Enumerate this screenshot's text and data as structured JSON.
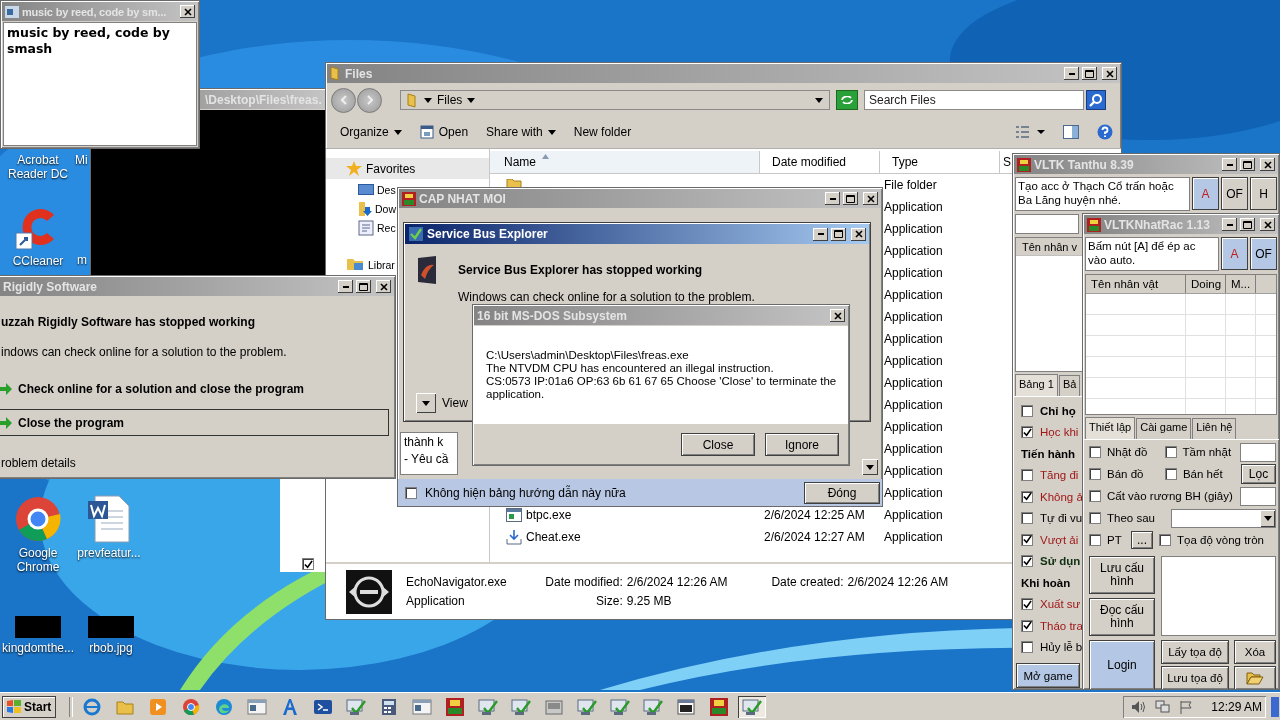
{
  "desktop_icons": [
    {
      "label": "Acrobat Reader DC",
      "kind": "none"
    },
    {
      "label": "Mi",
      "kind": "none"
    },
    {
      "label": "CCleaner",
      "kind": "ccleaner"
    },
    {
      "label": "m",
      "kind": "none"
    },
    {
      "label": "Google Chrome",
      "kind": "chrome"
    },
    {
      "label": "prevfeatur...",
      "kind": "document"
    },
    {
      "label": "kingdomthe...",
      "kind": "thumbnail"
    },
    {
      "label": "rbob.jpg",
      "kind": "thumbnail"
    }
  ],
  "console_window": {
    "title": "\\Desktop\\Files\\freas."
  },
  "music_window": {
    "title": "music by reed, code by sm...",
    "text": "music by reed, code by smash"
  },
  "back_window": {
    "checked": true
  },
  "explorer": {
    "title": "Files",
    "address": "Files",
    "search": {
      "placeholder": "Search Files"
    },
    "toolbar": [
      {
        "label": "Organize",
        "kind": "menu"
      },
      {
        "label": "Open",
        "kind": "open"
      },
      {
        "label": "Share with",
        "kind": "menu"
      },
      {
        "label": "New folder",
        "kind": "plain"
      }
    ],
    "sidebar": [
      {
        "label": "Favorites",
        "kind": "favorites",
        "selected": true
      },
      {
        "label": "Des",
        "kind": "desktop",
        "selected": false
      },
      {
        "label": "Dow",
        "kind": "downloads",
        "selected": false
      },
      {
        "label": "Rec",
        "kind": "recent",
        "selected": false
      },
      {
        "label": "Librar",
        "kind": "libraries",
        "selected": false
      }
    ],
    "columns": [
      {
        "label": "Name",
        "sorted": true
      },
      {
        "label": "Date modified",
        "sorted": false
      },
      {
        "label": "Type",
        "sorted": false
      },
      {
        "label": "S",
        "sorted": false
      }
    ],
    "rows": [
      {
        "type": "File folder",
        "kind": "folder"
      },
      {
        "type": "Application"
      },
      {
        "type": "Application"
      },
      {
        "type": "Application"
      },
      {
        "type": "Application"
      },
      {
        "type": "Application"
      },
      {
        "type": "Application"
      },
      {
        "type": "Application"
      },
      {
        "type": "Application"
      },
      {
        "type": "Application"
      },
      {
        "type": "Application"
      },
      {
        "type": "Application"
      },
      {
        "type": "Application"
      },
      {
        "type": "Application"
      },
      {
        "type": "Application"
      },
      {
        "name": "btpc.exe",
        "date": "2/6/2024 12:25 AM",
        "type": "Application",
        "kind": "window"
      },
      {
        "name": "Cheat.exe",
        "date": "2/6/2024 12:27 AM",
        "type": "Application",
        "kind": "download"
      }
    ],
    "details": {
      "name": "EchoNavigator.exe",
      "type": "Application",
      "modified_label": "Date modified:",
      "modified": "2/6/2024 12:26 AM",
      "created_label": "Date created:",
      "created": "2/6/2024 12:26 AM",
      "size_label": "Size:",
      "size": "9.25 MB"
    }
  },
  "rigidly_dialog": {
    "title": "Rigidly Software",
    "heading": "uzzah Rigidly Software has stopped working",
    "message": "indows can check online for a solution to the problem.",
    "options": [
      {
        "label": "Check online for a solution and close the program",
        "selected": false
      },
      {
        "label": "Close the program",
        "selected": true
      }
    ],
    "details": "roblem details"
  },
  "update_window": {
    "title": "CAP NHAT MOI",
    "note_lines": [
      "thành k",
      "- Yêu cầ"
    ],
    "hide_guide": {
      "label": "Không hiện bảng hướng dẫn này nữa",
      "checked": false
    },
    "close_button": "Đóng"
  },
  "servicebus_dialog": {
    "title": "Service Bus Explorer",
    "heading": "Service Bus Explorer has stopped working",
    "message": "Windows can check online for a solution to the problem.",
    "details_toggle": "View"
  },
  "msdos_dialog": {
    "title": "16 bit MS-DOS Subsystem",
    "message": [
      "C:\\Users\\admin\\Desktop\\Files\\freas.exe",
      "The NTVDM CPU has encountered an illegal instruction.",
      "CS:0573 IP:01a6 OP:63 6b 61 67 65 Choose 'Close' to terminate the application."
    ],
    "buttons": [
      "Close",
      "Ignore"
    ]
  },
  "tanthu_window": {
    "title": "VLTK Tanthu 8.39",
    "notice": "Tạo acc ở Thạch Cổ trấn hoặc Ba Lăng huyện nhé.",
    "mode_buttons": [
      {
        "label": "A",
        "selected": true
      },
      {
        "label": "OF",
        "selected": false
      },
      {
        "label": "H",
        "selected": false
      }
    ],
    "list_header": "Tên nhân v",
    "tabs": [
      {
        "label": "Bảng 1",
        "selected": true
      },
      {
        "label": "Bả",
        "selected": false
      }
    ],
    "options": [
      {
        "kind": "check",
        "label": "Chỉ họ",
        "checked": false,
        "bold": true,
        "color": "#000000"
      },
      {
        "kind": "check",
        "label": "Học khi",
        "checked": true,
        "bold": false,
        "color": "#a01818"
      },
      {
        "kind": "heading",
        "label": "Tiến hành"
      },
      {
        "kind": "check",
        "label": "Tăng đi",
        "checked": false,
        "bold": false,
        "color": "#a01818"
      },
      {
        "kind": "check",
        "label": "Không ả",
        "checked": true,
        "bold": false,
        "color": "#a01818"
      },
      {
        "kind": "check",
        "label": "Tự đi vu",
        "checked": false,
        "bold": false,
        "color": "#000000"
      },
      {
        "kind": "check",
        "label": "Vượt ải",
        "checked": true,
        "bold": false,
        "color": "#a01818"
      },
      {
        "kind": "check",
        "label": "Sử dụn",
        "checked": true,
        "bold": true,
        "color": "#103010"
      },
      {
        "kind": "heading",
        "label": "Khi hoàn"
      },
      {
        "kind": "check",
        "label": "Xuất sư",
        "checked": true,
        "bold": false,
        "color": "#a01818"
      },
      {
        "kind": "check",
        "label": "Tháo tra",
        "checked": true,
        "bold": false,
        "color": "#a01818"
      },
      {
        "kind": "check",
        "label": "Hủy lễ b",
        "checked": false,
        "bold": false,
        "color": "#000000"
      }
    ],
    "open_game_button": "Mở game"
  },
  "nhatrac_window": {
    "title": "VLTKNhatRac 1.13",
    "notice": "Bấm nút [A] để ép ac vào auto.",
    "mode_buttons": [
      {
        "label": "A",
        "selected": true
      },
      {
        "label": "OF",
        "selected": true
      }
    ],
    "columns": [
      "Tên nhân vật",
      "Doing",
      "M..."
    ],
    "tabs": [
      {
        "label": "Thiết lập",
        "selected": true
      },
      {
        "label": "Cài game",
        "selected": false
      },
      {
        "label": "Liên hệ",
        "selected": false
      }
    ],
    "pick_items": {
      "label": "Nhặt đồ",
      "checked": false
    },
    "pick_range": {
      "label": "Tầm nhặt",
      "checked": false
    },
    "sell_items": {
      "label": "Bán đồ",
      "checked": false
    },
    "sell_all": {
      "label": "Bán hết",
      "checked": false
    },
    "filter_button": "Lọc",
    "store_chest": {
      "label": "Cất vào rương BH (giây)",
      "checked": false
    },
    "follow": {
      "label": "Theo sau",
      "checked": false
    },
    "party": {
      "label": "PT",
      "checked": false
    },
    "party_button": "...",
    "circle_coords": {
      "label": "Tọa độ vòng tròn",
      "checked": false
    },
    "save_config": "Lưu cấu hình",
    "load_config": "Đọc cấu hình",
    "login": "Login",
    "get_coords": "Lấy tọa độ",
    "delete": "Xóa",
    "save_coords": "Lưu tọa độ"
  },
  "taskbar": {
    "start": "Start",
    "items": [
      {
        "kind": "ie",
        "selected": false
      },
      {
        "kind": "folder",
        "selected": false
      },
      {
        "kind": "media",
        "selected": false
      },
      {
        "kind": "chrome",
        "selected": false
      },
      {
        "kind": "edge",
        "selected": false
      },
      {
        "kind": "window",
        "selected": false
      },
      {
        "kind": "font",
        "selected": false
      },
      {
        "kind": "terminal",
        "selected": false
      },
      {
        "kind": "checkapp",
        "selected": false
      },
      {
        "kind": "calc",
        "selected": false
      },
      {
        "kind": "window",
        "selected": false
      },
      {
        "kind": "game",
        "selected": false
      },
      {
        "kind": "checkapp",
        "selected": false
      },
      {
        "kind": "checkapp",
        "selected": false
      },
      {
        "kind": "scanner",
        "selected": false
      },
      {
        "kind": "checkapp",
        "selected": false
      },
      {
        "kind": "checkapp",
        "selected": false
      },
      {
        "kind": "checkapp",
        "selected": false
      },
      {
        "kind": "cmd",
        "selected": false
      },
      {
        "kind": "game",
        "selected": false
      },
      {
        "kind": "checkapp",
        "selected": true
      }
    ],
    "clock": "12:29 AM"
  }
}
